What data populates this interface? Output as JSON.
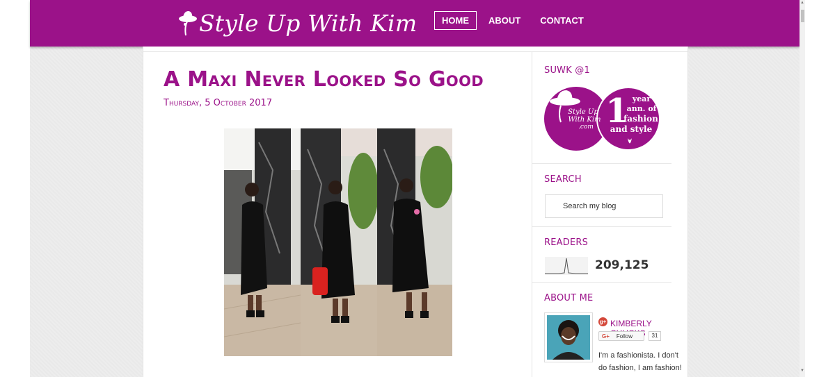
{
  "header": {
    "logo_text": "Style Up With Kim",
    "nav": [
      {
        "label": "HOME",
        "active": true
      },
      {
        "label": "ABOUT",
        "active": false
      },
      {
        "label": "CONTACT",
        "active": false
      }
    ]
  },
  "post": {
    "title": "A Maxi Never Looked So Good",
    "date": "Thursday, 5 October 2017"
  },
  "sidebar": {
    "anniversary": {
      "title": "SUWK @1",
      "badge_left_line1": "Style Up",
      "badge_left_line2": "With Kim",
      "badge_left_line3": ".com",
      "badge_number": "1",
      "badge_right_line1": "year",
      "badge_right_line2": "ann. of",
      "badge_right_line3": "fashion",
      "badge_right_line4": "and style"
    },
    "search": {
      "title": "SEARCH",
      "placeholder": "Search my blog"
    },
    "readers": {
      "title": "READERS",
      "count": "209,125"
    },
    "about": {
      "title": "ABOUT ME",
      "name": "KIMBERLY CHUCKS",
      "follow_label": "Follow",
      "follow_count": "31",
      "bio": "I'm a fashionista. I don't do fashion, I am fashion!"
    }
  },
  "colors": {
    "brand": "#9b1289",
    "page_bg": "#ededed"
  }
}
